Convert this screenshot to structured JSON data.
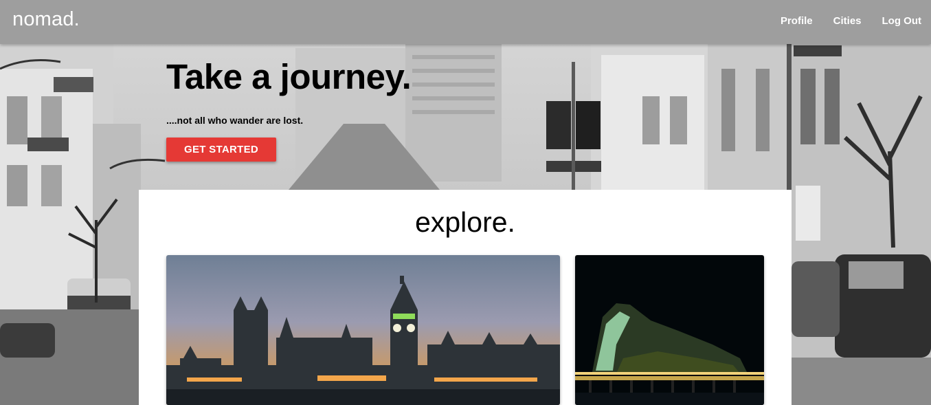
{
  "navbar": {
    "brand": "nomad.",
    "links": [
      {
        "label": "Profile"
      },
      {
        "label": "Cities"
      },
      {
        "label": "Log Out"
      }
    ]
  },
  "hero": {
    "title": "Take a journey.",
    "subtitle": "....not all who wander are lost.",
    "cta_label": "GET STARTED",
    "cta_color": "#e53935"
  },
  "explore": {
    "title": "explore.",
    "cities": [
      {
        "icon": "london-skyline-photo"
      },
      {
        "icon": "gibraltar-rock-night-photo"
      }
    ]
  }
}
